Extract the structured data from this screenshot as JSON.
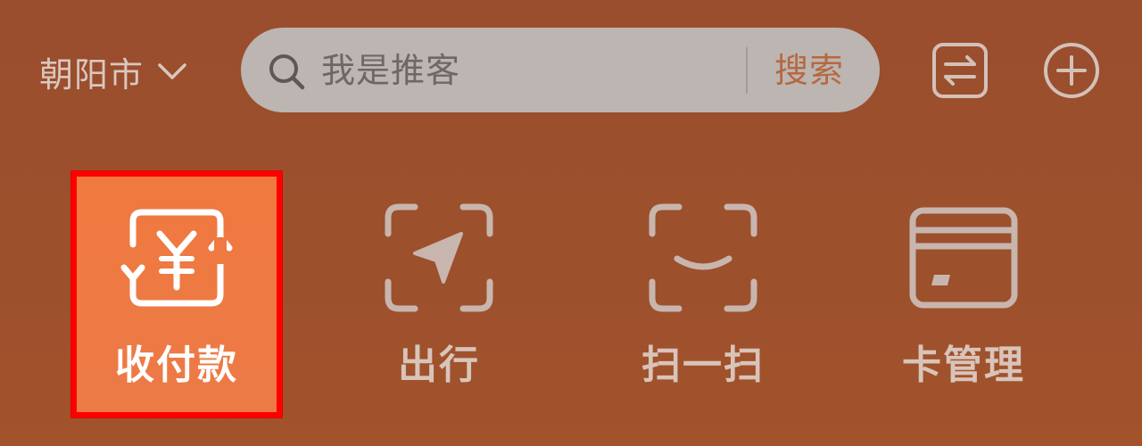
{
  "header": {
    "city": "朝阳市",
    "search": {
      "placeholder": "我是推客",
      "button_label": "搜索"
    }
  },
  "shortcuts": [
    {
      "label": "收付款",
      "icon": "payment-yuan-icon",
      "highlighted": true
    },
    {
      "label": "出行",
      "icon": "navigation-arrow-icon",
      "highlighted": false
    },
    {
      "label": "扫一扫",
      "icon": "scan-icon",
      "highlighted": false
    },
    {
      "label": "卡管理",
      "icon": "card-icon",
      "highlighted": false
    }
  ],
  "colors": {
    "background": "#9c502c",
    "search_bg": "#bcb5b2",
    "accent": "#f0793f",
    "highlight_border": "#ff0000",
    "muted_text": "#d9c4ba"
  }
}
